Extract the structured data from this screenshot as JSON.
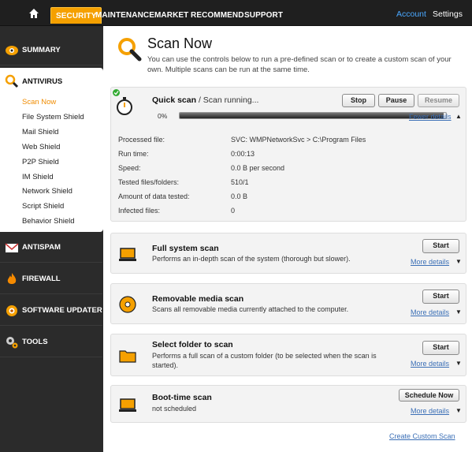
{
  "topnav": {
    "tabs": [
      "SECURITY",
      "MAINTENANCE",
      "MARKET",
      "RECOMMEND",
      "SUPPORT"
    ],
    "account": "Account",
    "settings": "Settings"
  },
  "sidebar": {
    "summary": "SUMMARY",
    "antivirus": "ANTIVIRUS",
    "antivirus_items": [
      "Scan Now",
      "File System Shield",
      "Mail Shield",
      "Web Shield",
      "P2P Shield",
      "IM Shield",
      "Network Shield",
      "Script Shield",
      "Behavior Shield"
    ],
    "antispam": "ANTISPAM",
    "firewall": "FIREWALL",
    "software_updater": "SOFTWARE UPDATER",
    "tools": "TOOLS"
  },
  "main": {
    "title": "Scan Now",
    "description": "You can use the controls below to run a pre-defined scan or to create a custom scan of your own. Multiple scans can be run at the same time.",
    "quick_scan": {
      "title": "Quick scan",
      "status": " / Scan running...",
      "progress_label": "0%",
      "progress": 0.99,
      "stop": "Stop",
      "pause": "Pause",
      "resume": "Resume",
      "fewer_details": "Fewer details",
      "details": [
        {
          "label": "Processed file:",
          "value": "SVC: WMPNetworkSvc > C:\\Program Files"
        },
        {
          "label": "Run time:",
          "value": "0:00:13"
        },
        {
          "label": "Speed:",
          "value": "0.0 B per second"
        },
        {
          "label": "Tested files/folders:",
          "value": "510/1"
        },
        {
          "label": "Amount of data tested:",
          "value": "0.0 B"
        },
        {
          "label": "Infected files:",
          "value": "0"
        }
      ]
    },
    "scans": [
      {
        "title": "Full system scan",
        "desc": "Performs an in-depth scan of the system (thorough but slower).",
        "button": "Start",
        "more": "More details"
      },
      {
        "title": "Removable media scan",
        "desc": "Scans all removable media currently attached to the computer.",
        "button": "Start",
        "more": "More details"
      },
      {
        "title": "Select folder to scan",
        "desc": "Performs a full scan of a custom folder (to be selected when the scan is started).",
        "button": "Start",
        "more": "More details"
      },
      {
        "title": "Boot-time scan",
        "desc": "not scheduled",
        "button": "Schedule Now",
        "more": "More details"
      }
    ],
    "create_custom": "Create Custom Scan"
  },
  "colors": {
    "accent": "#f5a000",
    "link": "#3b6fb6",
    "sidebar": "#2b2b2b"
  }
}
